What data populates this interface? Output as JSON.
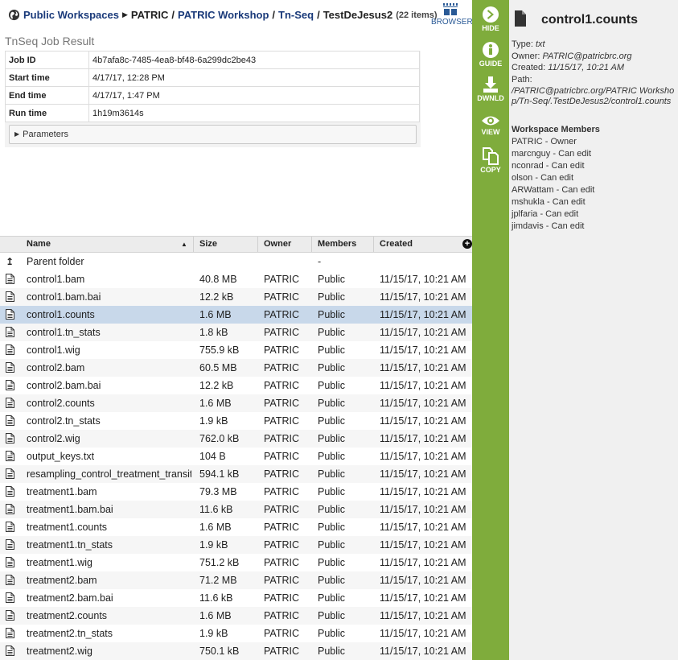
{
  "breadcrumb": {
    "root": "Public Workspaces",
    "items": [
      "PATRIC",
      "PATRIC Workshop",
      "Tn-Seq"
    ],
    "current": "TestDeJesus2",
    "count": "(22 items)"
  },
  "browser_label": "BROWSER",
  "job": {
    "title": "TnSeq Job Result",
    "rows": [
      {
        "key": "Job ID",
        "value": "4b7afa8c-7485-4ea8-bf48-6a299dc2be43"
      },
      {
        "key": "Start time",
        "value": "4/17/17, 12:28 PM"
      },
      {
        "key": "End time",
        "value": "4/17/17, 1:47 PM"
      },
      {
        "key": "Run time",
        "value": "1h19m3614s"
      }
    ],
    "parameters_label": "Parameters"
  },
  "grid": {
    "columns": [
      "Name",
      "Size",
      "Owner",
      "Members",
      "Created"
    ],
    "parent": {
      "name": "Parent folder",
      "members": "-"
    },
    "rows": [
      {
        "name": "control1.bam",
        "size": "40.8 MB",
        "owner": "PATRIC",
        "members": "Public",
        "created": "11/15/17, 10:21 AM"
      },
      {
        "name": "control1.bam.bai",
        "size": "12.2 kB",
        "owner": "PATRIC",
        "members": "Public",
        "created": "11/15/17, 10:21 AM"
      },
      {
        "name": "control1.counts",
        "size": "1.6 MB",
        "owner": "PATRIC",
        "members": "Public",
        "created": "11/15/17, 10:21 AM"
      },
      {
        "name": "control1.tn_stats",
        "size": "1.8 kB",
        "owner": "PATRIC",
        "members": "Public",
        "created": "11/15/17, 10:21 AM"
      },
      {
        "name": "control1.wig",
        "size": "755.9 kB",
        "owner": "PATRIC",
        "members": "Public",
        "created": "11/15/17, 10:21 AM"
      },
      {
        "name": "control2.bam",
        "size": "60.5 MB",
        "owner": "PATRIC",
        "members": "Public",
        "created": "11/15/17, 10:21 AM"
      },
      {
        "name": "control2.bam.bai",
        "size": "12.2 kB",
        "owner": "PATRIC",
        "members": "Public",
        "created": "11/15/17, 10:21 AM"
      },
      {
        "name": "control2.counts",
        "size": "1.6 MB",
        "owner": "PATRIC",
        "members": "Public",
        "created": "11/15/17, 10:21 AM"
      },
      {
        "name": "control2.tn_stats",
        "size": "1.9 kB",
        "owner": "PATRIC",
        "members": "Public",
        "created": "11/15/17, 10:21 AM"
      },
      {
        "name": "control2.wig",
        "size": "762.0 kB",
        "owner": "PATRIC",
        "members": "Public",
        "created": "11/15/17, 10:21 AM"
      },
      {
        "name": "output_keys.txt",
        "size": "104 B",
        "owner": "PATRIC",
        "members": "Public",
        "created": "11/15/17, 10:21 AM"
      },
      {
        "name": "resampling_control_treatment_transit",
        "size": "594.1 kB",
        "owner": "PATRIC",
        "members": "Public",
        "created": "11/15/17, 10:21 AM"
      },
      {
        "name": "treatment1.bam",
        "size": "79.3 MB",
        "owner": "PATRIC",
        "members": "Public",
        "created": "11/15/17, 10:21 AM"
      },
      {
        "name": "treatment1.bam.bai",
        "size": "11.6 kB",
        "owner": "PATRIC",
        "members": "Public",
        "created": "11/15/17, 10:21 AM"
      },
      {
        "name": "treatment1.counts",
        "size": "1.6 MB",
        "owner": "PATRIC",
        "members": "Public",
        "created": "11/15/17, 10:21 AM"
      },
      {
        "name": "treatment1.tn_stats",
        "size": "1.9 kB",
        "owner": "PATRIC",
        "members": "Public",
        "created": "11/15/17, 10:21 AM"
      },
      {
        "name": "treatment1.wig",
        "size": "751.2 kB",
        "owner": "PATRIC",
        "members": "Public",
        "created": "11/15/17, 10:21 AM"
      },
      {
        "name": "treatment2.bam",
        "size": "71.2 MB",
        "owner": "PATRIC",
        "members": "Public",
        "created": "11/15/17, 10:21 AM"
      },
      {
        "name": "treatment2.bam.bai",
        "size": "11.6 kB",
        "owner": "PATRIC",
        "members": "Public",
        "created": "11/15/17, 10:21 AM"
      },
      {
        "name": "treatment2.counts",
        "size": "1.6 MB",
        "owner": "PATRIC",
        "members": "Public",
        "created": "11/15/17, 10:21 AM"
      },
      {
        "name": "treatment2.tn_stats",
        "size": "1.9 kB",
        "owner": "PATRIC",
        "members": "Public",
        "created": "11/15/17, 10:21 AM"
      },
      {
        "name": "treatment2.wig",
        "size": "750.1 kB",
        "owner": "PATRIC",
        "members": "Public",
        "created": "11/15/17, 10:21 AM"
      }
    ],
    "selected_index": 2
  },
  "actions": [
    {
      "label": "HIDE",
      "icon": "chevron-right-circle-icon"
    },
    {
      "label": "GUIDE",
      "icon": "info-circle-icon"
    },
    {
      "label": "DWNLD",
      "icon": "download-icon"
    },
    {
      "label": "VIEW",
      "icon": "eye-icon"
    },
    {
      "label": "COPY",
      "icon": "copy-icon"
    }
  ],
  "details": {
    "title": "control1.counts",
    "type_label": "Type:",
    "type": "txt",
    "owner_label": "Owner:",
    "owner": "PATRIC@patricbrc.org",
    "created_label": "Created:",
    "created": "11/15/17, 10:21 AM",
    "path_label": "Path:",
    "path": "/PATRIC@patricbrc.org/PATRIC Workshop/Tn-Seq/.TestDeJesus2/control1.counts",
    "members_heading": "Workspace Members",
    "members": [
      "PATRIC - Owner",
      "marcnguy - Can edit",
      "nconrad - Can edit",
      "olson - Can edit",
      "ARWattam - Can edit",
      "mshukla - Can edit",
      "jplfaria - Can edit",
      "jimdavis - Can edit"
    ]
  },
  "colors": {
    "action_bar": "#7fac3c",
    "link": "#1a3a7a",
    "selected_row": "#c8d8ea"
  }
}
